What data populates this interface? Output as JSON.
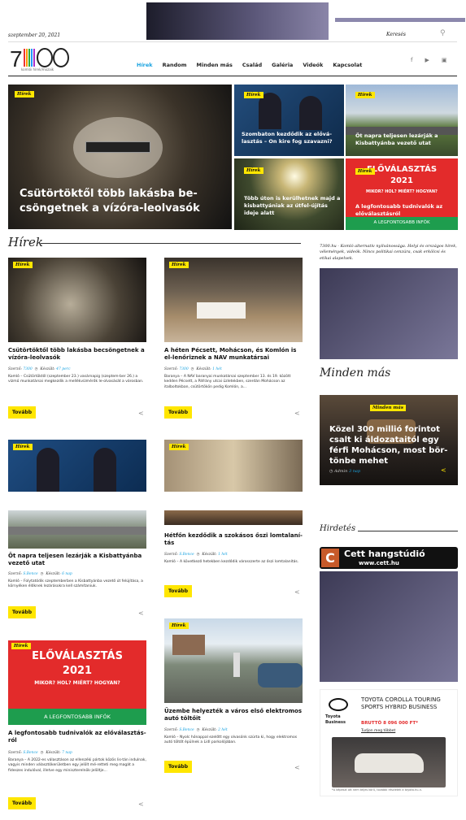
{
  "header": {
    "date": "szeptember 20, 2021",
    "search_label": "Keresés",
    "logo_sub": "komlói hírek/mozaik"
  },
  "nav": [
    "Hírek",
    "Random",
    "Minden más",
    "Család",
    "Galéria",
    "Videók",
    "Kapcsolat"
  ],
  "badge": "Hírek",
  "featured": {
    "main": "Csütörtöktől több lakásba be-csöngetnek a vízóra-leolvasók",
    "t1": "Szombaton kezdődik az elővá-lasztás – On kire fog szavazni?",
    "t2": "Öt napra teljesen lezárják a Kisbattyánba vezető utat",
    "t3": "Több úton is kerülhetnek majd a kisbattyániak az útfel-újítás ideje alatt",
    "t4": "A legfontosabb tudnivalók az előválasztásról",
    "t4_line1": "ELŐVÁLASZTÁS",
    "t4_line2": "2021",
    "t4_line3": "MIKOR? HOL? MIÉRT? HOGYAN?",
    "t4_line4": "A LEGFONTOSABB INFÓK"
  },
  "section_title": "Hírek",
  "btn": "Tovább",
  "meta_author_lbl": "Szerző:",
  "meta_date_lbl": "Készült:",
  "cards": [
    {
      "title": "Csütörtöktől több lakásba becsöngetnek a vízóra-leolvasók",
      "author": "7300",
      "date": "47 perc",
      "excerpt": "Komló – Csütörtöktől (szeptember 23.) vasárnapig (szeptem-ber 26.) a vízmű munkatársai megkezdik a mellékvízmérők le-olvasását a városban."
    },
    {
      "title": "A héten Pécsett, Mohácson, és Komlón is el-lenőriznek a NAV munkatársai",
      "author": "7300",
      "date": "1 hét",
      "excerpt": "Baranya – A NAV baranyai munkatársai szeptember 13. és 19. között kedden Pécsett, a Páfrány utcai üzletekben, szerdán Mohácson az italboltokban, csütörtökön pedig Komlón, a..."
    },
    {
      "title": "Öt napra teljesen lezárják a Kisbattyánba vezető utat",
      "author": "S.Bence",
      "date": "6 nap",
      "excerpt": "Komló – Folytatódik szeptemberben a Kisbattyánba vezető út felújítása, a környéken élőknek lezárásokra kell számítaniuk."
    },
    {
      "title": "Hétfőn kezdődik a szokásos őszi lomtalaní-tás",
      "author": "S.Bence",
      "date": "1 hét",
      "excerpt": "Komló – A következő hetekben kezdődik városszerte az őszi lomtalanítás."
    },
    {
      "title": "A legfontosabb tudnivalók az előválasztás-ról",
      "author": "S.Bence",
      "date": "7 nap",
      "excerpt": "Baranya – A 2022-es választáson az ellenzéki pártok közös lis-tán indulnak, vagyis minden választókerületben egy jelölt mé-retteti meg magát a fideszes indulóval, illetve egy miniszterelnök-jelöltje..."
    },
    {
      "title": "Üzembe helyezték a város első elektromos autó töltőit",
      "author": "S.Bence",
      "date": "2 hét",
      "excerpt": "Komló – Nyolc hónappal ezelőtt egy olvasónk szúrta ki, hogy elektromos autó töltőt épülnek a Lidl parkolójában."
    }
  ],
  "sidebar": {
    "text": "7300.hu - Komló alternatív nyilvánossága. Helyi és országos hírek, vélemények, videók. Nincs politikai cenzúra, csak erkölcsi és etikai alapelvek.",
    "minden_mas": "Minden más",
    "mm_badge": "Minden más",
    "mm_title": "Közel 300 millió forintot csalt ki áldozataitól egy férfi Mohácson, most bör-tönbe mehet",
    "mm_author": "Admin",
    "mm_date": "3 nap",
    "hirdetes": "Hirdetés",
    "cett": "Cett hangstúdió",
    "cett_url": "www.cett.hu",
    "toyota_brand": "Toyota Business",
    "toyota_title": "TOYOTA COROLLA TOURING SPORTS HYBRID BUSINESS",
    "toyota_price": "BRUTTÓ 8 096 000 FT*",
    "toyota_link": "Tudjon meg többet",
    "toyota_fine": "*A képeszt ott nem teljes körű, további részletek a toyota.hu-n."
  }
}
